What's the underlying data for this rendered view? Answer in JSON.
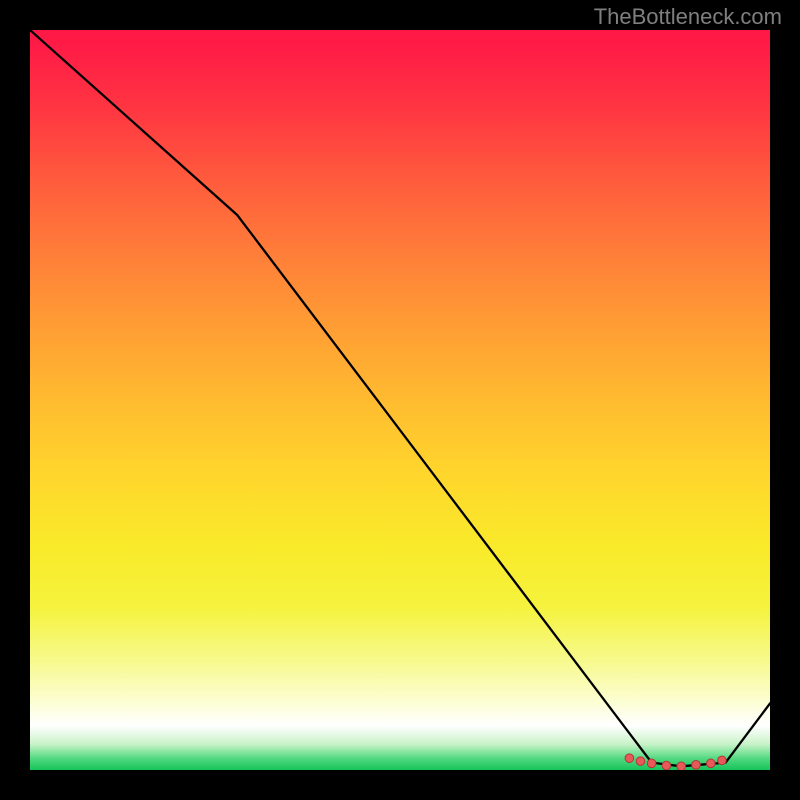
{
  "watermark": "TheBottleneck.com",
  "chart_data": {
    "type": "line",
    "title": "",
    "xlabel": "",
    "ylabel": "",
    "xlim": [
      0,
      100
    ],
    "ylim": [
      0,
      100
    ],
    "series": [
      {
        "name": "curve",
        "x": [
          0,
          28,
          84,
          88,
          94,
          100
        ],
        "y": [
          100,
          75,
          1,
          0.5,
          1,
          9
        ]
      }
    ],
    "markers": {
      "name": "min-region",
      "points": [
        {
          "x": 81,
          "y": 1.6
        },
        {
          "x": 82.5,
          "y": 1.2
        },
        {
          "x": 84,
          "y": 0.9
        },
        {
          "x": 86,
          "y": 0.6
        },
        {
          "x": 88,
          "y": 0.5
        },
        {
          "x": 90,
          "y": 0.7
        },
        {
          "x": 92,
          "y": 0.9
        },
        {
          "x": 93.5,
          "y": 1.3
        }
      ]
    },
    "gradient_stops": [
      {
        "pos": 0,
        "color": "#ff1846"
      },
      {
        "pos": 0.5,
        "color": "#ffbb30"
      },
      {
        "pos": 0.92,
        "color": "#fcfed6"
      },
      {
        "pos": 1.0,
        "color": "#16c45b"
      }
    ]
  }
}
